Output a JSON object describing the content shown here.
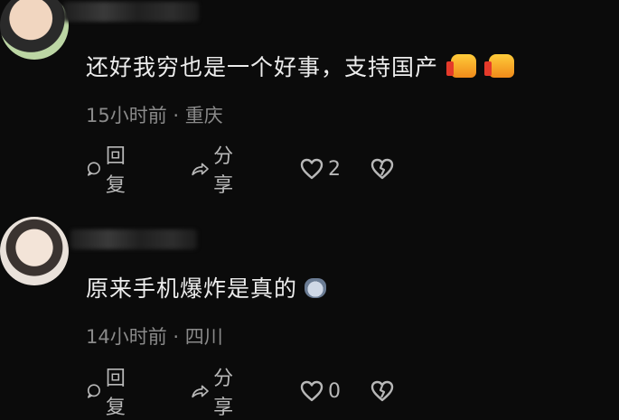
{
  "comments": [
    {
      "text": "还好我穷也是一个好事，支持国产",
      "emoji": [
        "thumbs-up-emoji",
        "thumbs-up-emoji"
      ],
      "time": "15小时前",
      "separator": "·",
      "location": "重庆",
      "reply_label": "回复",
      "share_label": "分享",
      "likes": "2"
    },
    {
      "text": "原来手机爆炸是真的",
      "emoji": [
        "cat-emoji"
      ],
      "time": "14小时前",
      "separator": "·",
      "location": "四川",
      "reply_label": "回复",
      "share_label": "分享",
      "likes": "0"
    }
  ],
  "colors": {
    "background": "#0b0b0b",
    "text": "#ececec",
    "meta": "#8a8a8a",
    "action": "#b8b8b8"
  }
}
